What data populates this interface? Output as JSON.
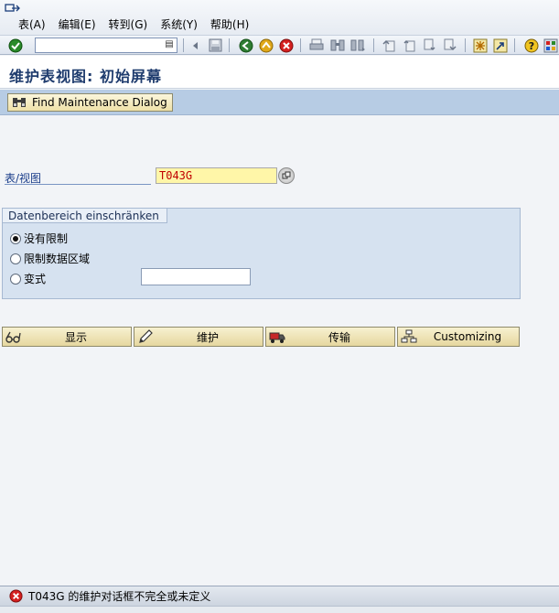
{
  "menu": {
    "items": [
      "表(A)",
      "编辑(E)",
      "转到(G)",
      "系统(Y)",
      "帮助(H)"
    ]
  },
  "toolbar": {
    "command_value": "",
    "icons": [
      "enter-icon",
      "command-dropdown-icon",
      "back-arrow-icon",
      "save-icon",
      "back-icon",
      "exit-icon",
      "cancel-icon",
      "print-icon",
      "find-icon",
      "find-next-icon",
      "first-page-icon",
      "previous-page-icon",
      "next-page-icon",
      "last-page-icon",
      "new-session-icon",
      "shortcut-icon",
      "help-icon",
      "layout-icon"
    ]
  },
  "title": {
    "text": "维护表视图: 初始屏幕"
  },
  "app_toolbar": {
    "find_dialog_label": "Find Maintenance Dialog"
  },
  "form": {
    "table_label": "表/视图",
    "table_value": "T043G",
    "group_title": "Datenbereich einschränken",
    "radio_options": [
      "没有限制",
      "限制数据区域",
      "变式"
    ],
    "selected_option": "没有限制",
    "variant_value": ""
  },
  "actions": {
    "display_label": "显示",
    "maintain_label": "维护",
    "transport_label": "传输",
    "customizing_label": "Customizing"
  },
  "status": {
    "message": "T043G 的维护对话框不完全或未定义",
    "type": "error",
    "error_color": "#d42020"
  }
}
